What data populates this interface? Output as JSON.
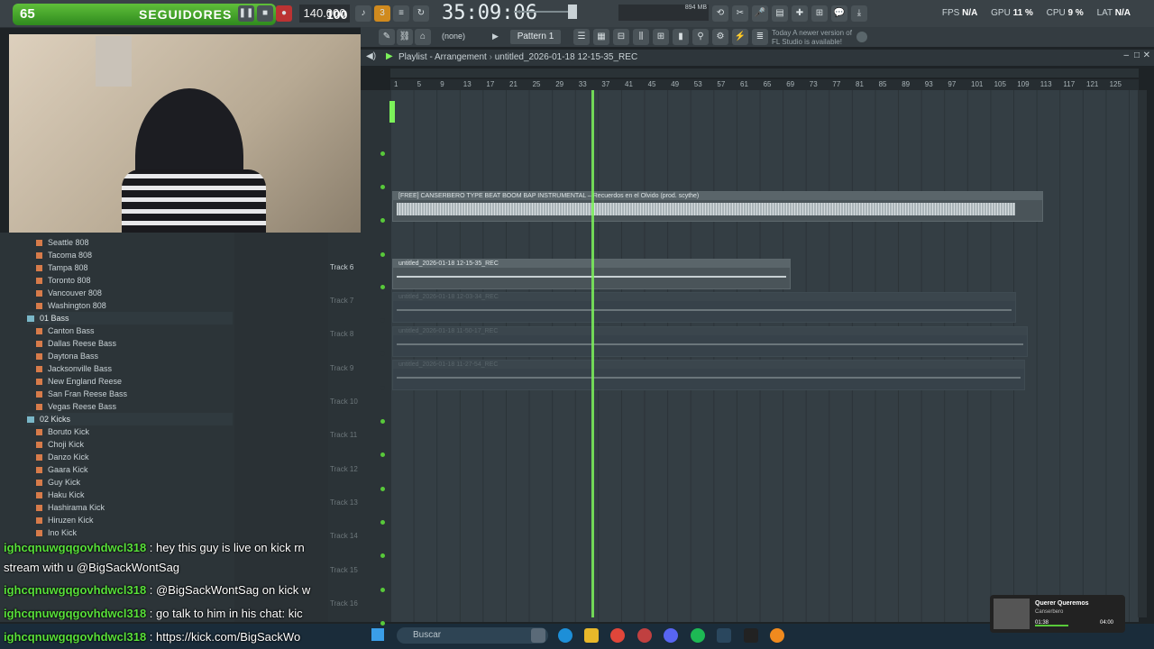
{
  "toolbar": {
    "follow_count": "65",
    "follow_label": "SEGUIDORES",
    "tempo": "140.000",
    "tempo_big": "100",
    "time": "35:09:06",
    "memory": "894 MB",
    "cpu_stats": [
      {
        "label": "FPS",
        "value": "N/A"
      },
      {
        "label": "GPU",
        "value": "11 %"
      },
      {
        "label": "CPU",
        "value": "9 %"
      },
      {
        "label": "LAT",
        "value": "N/A"
      }
    ],
    "pattern": "Pattern 1",
    "none_select": "(none)",
    "update_msg": "Today  A newer version of FL Studio is available!"
  },
  "playlist": {
    "title": "Playlist - Arrangement",
    "breadcrumb": "untitled_2026-01-18 12-15-35_REC",
    "ruler": [
      "1",
      "5",
      "9",
      "13",
      "17",
      "21",
      "25",
      "29",
      "33",
      "37",
      "41",
      "45",
      "49",
      "53",
      "57",
      "61",
      "65",
      "69",
      "73",
      "77",
      "81",
      "85",
      "89",
      "93",
      "97",
      "101",
      "105",
      "109",
      "113",
      "117",
      "121",
      "125"
    ],
    "tracks": [
      {
        "label": "Track 6",
        "active": true
      },
      {
        "label": "Track 7",
        "active": false
      },
      {
        "label": "Track 8",
        "active": false
      },
      {
        "label": "Track 9",
        "active": false
      },
      {
        "label": "Track 10",
        "active": false
      },
      {
        "label": "Track 11",
        "active": false
      },
      {
        "label": "Track 12",
        "active": false
      },
      {
        "label": "Track 13",
        "active": false
      },
      {
        "label": "Track 14",
        "active": false
      },
      {
        "label": "Track 15",
        "active": false
      },
      {
        "label": "Track 16",
        "active": false
      }
    ],
    "clips": [
      {
        "name": "[FREE] CANSERBERO TYPE BEAT  BOOM BAP INSTRUMENTAL – Recuerdos en el Olvido (prod. scythe)"
      },
      {
        "name": "untitled_2026-01-18 12-15-35_REC"
      },
      {
        "name": "untitled_2026-01-18 12-03-34_REC"
      },
      {
        "name": "untitled_2026-01-18 11-50-17_REC"
      },
      {
        "name": "untitled_2026-01-18 11-27-54_REC"
      }
    ]
  },
  "browser": {
    "items_808": [
      "Seattle 808",
      "Tacoma 808",
      "Tampa 808",
      "Toronto 808",
      "Vancouver 808",
      "Washington 808"
    ],
    "folder_bass": "01 Bass",
    "items_bass": [
      "Canton Bass",
      "Dallas Reese Bass",
      "Daytona Bass",
      "Jacksonville Bass",
      "New England Reese",
      "San Fran Reese Bass",
      "Vegas Reese Bass"
    ],
    "folder_kicks": "02 Kicks",
    "items_kicks": [
      "Boruto Kick",
      "Choji Kick",
      "Danzo Kick",
      "Gaara Kick",
      "Guy Kick",
      "Haku Kick",
      "Hashirama Kick",
      "Hiruzen Kick",
      "Ino Kick"
    ]
  },
  "chat": [
    {
      "user": "ighcqnuwgqgovhdwcl318",
      "msg": " : hey this guy is live on kick rn"
    },
    {
      "user": "",
      "msg": "stream with u @BigSackWontSag"
    },
    {
      "user": "ighcqnuwgqgovhdwcl318",
      "msg": " : @BigSackWontSag on kick w"
    },
    {
      "user": "ighcqnuwgqgovhdwcl318",
      "msg": " : go talk to him in his chat: kic"
    },
    {
      "user": "ighcqnuwgqgovhdwcl318",
      "msg": " : https://kick.com/BigSackWo"
    }
  ],
  "taskbar": {
    "search": "Buscar"
  },
  "media": {
    "title": "Querer Queremos",
    "artist": "Canserbero",
    "time_current": "01:38",
    "time_total": "04:00",
    "progress": 0.41
  }
}
